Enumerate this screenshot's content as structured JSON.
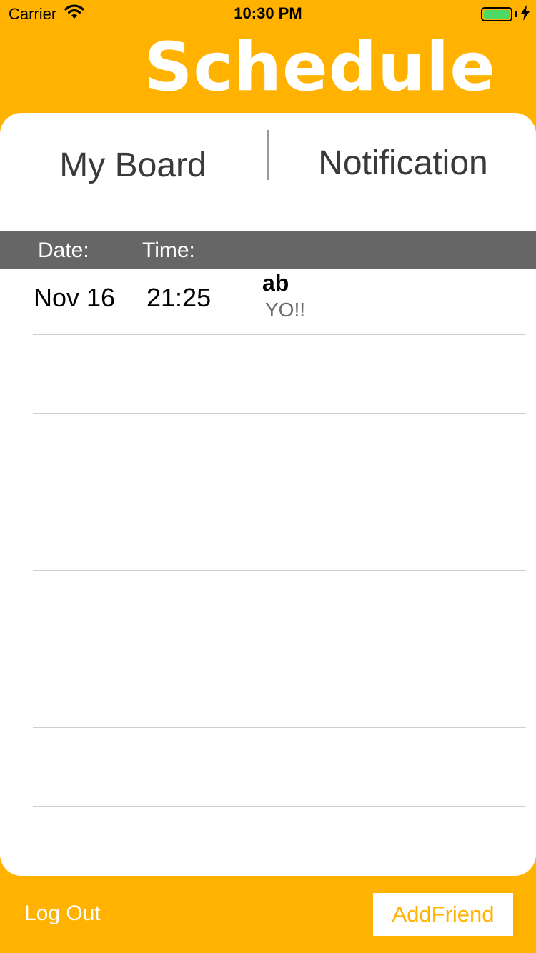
{
  "status_bar": {
    "carrier": "Carrier",
    "time": "10:30 PM",
    "wifi_icon": "wifi-icon",
    "battery_icon": "battery-icon",
    "charging_icon": "charging-bolt-icon",
    "battery_color": "#4CD964"
  },
  "header": {
    "title": "Schedule"
  },
  "tabs": [
    {
      "label": "My Board"
    },
    {
      "label": "Notification"
    }
  ],
  "table": {
    "columns": {
      "date": "Date:",
      "time": "Time:"
    },
    "rows": [
      {
        "date": "Nov 16",
        "time": "21:25",
        "sender": "ab",
        "message": "YO!!"
      }
    ]
  },
  "footer": {
    "logout_label": "Log Out",
    "add_friend_label": "AddFriend"
  },
  "colors": {
    "accent": "#FFB300",
    "header_row_bg": "#666666",
    "panel_bg": "#FFFFFF"
  }
}
